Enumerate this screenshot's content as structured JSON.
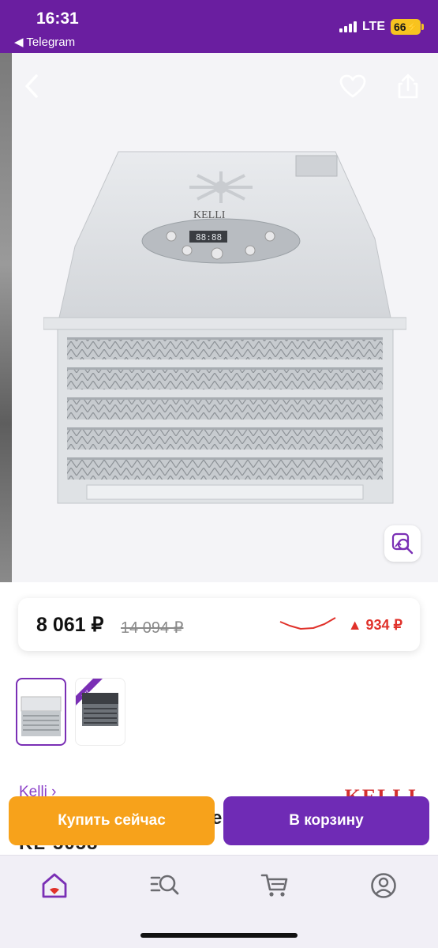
{
  "status_bar": {
    "time": "16:31",
    "back_app": "◀ Telegram",
    "network": "LTE",
    "battery": "66"
  },
  "gallery": {
    "product_brand_mark": "KELLI",
    "appliance_display": "88:88"
  },
  "price": {
    "current": "8 061 ₽",
    "old": "14 094 ₽",
    "change": "▲ 934 ₽",
    "trend_direction": "down-up",
    "change_color": "#e0312a"
  },
  "thumbnails": [
    {
      "selected": true
    },
    {
      "badge": "хит",
      "selected": false
    }
  ],
  "brand": {
    "link": "Kelli ›",
    "logo_text": "KELLI"
  },
  "title_fragments": {
    "partial_1": "е",
    "partial_2": "KL-5058"
  },
  "actions": {
    "buy_now": "Купить сейчас",
    "add_to_cart": "В корзину"
  },
  "tabs": [
    {
      "icon": "home-icon",
      "active": true
    },
    {
      "icon": "catalog-search-icon",
      "active": false
    },
    {
      "icon": "cart-icon",
      "active": false
    },
    {
      "icon": "profile-icon",
      "active": false
    }
  ],
  "colors": {
    "header": "#6a1ea0",
    "accent": "#7a2fb5",
    "buy_now": "#f7a21b",
    "add_to_cart": "#6f2bb5"
  }
}
